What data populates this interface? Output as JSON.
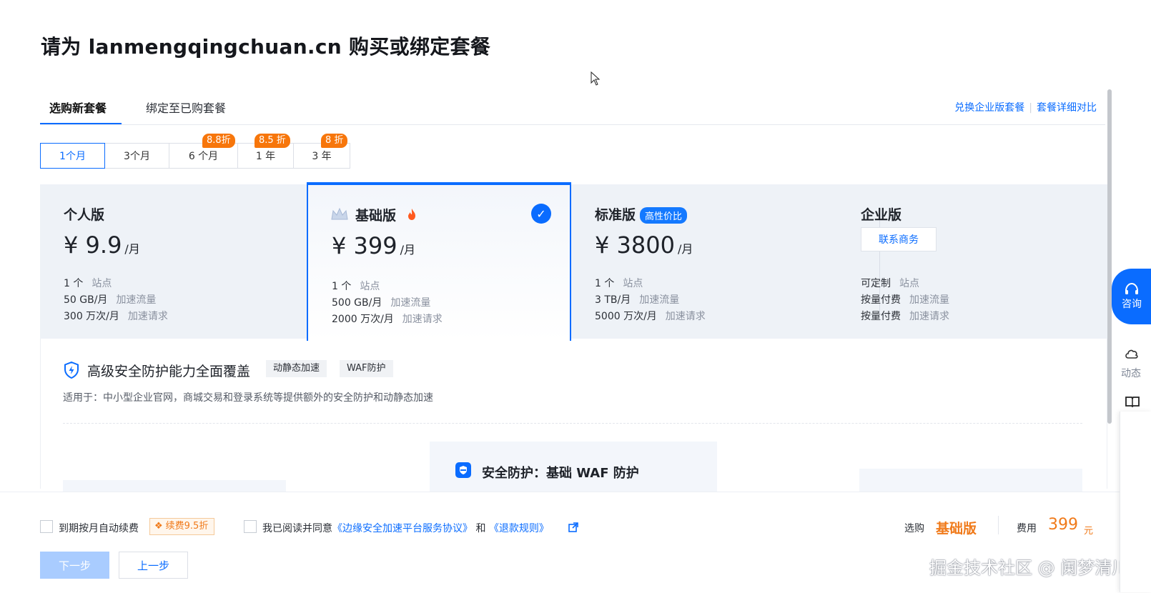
{
  "page": {
    "title": "请为 lanmengqingchuan.cn 购买或绑定套餐"
  },
  "tabs": [
    {
      "label": "选购新套餐",
      "active": true
    },
    {
      "label": "绑定至已购套餐",
      "active": false
    }
  ],
  "top_links": {
    "redeem": "兑换企业版套餐",
    "compare": "套餐详细对比"
  },
  "durations": [
    {
      "label": "1个月",
      "active": true,
      "discount": ""
    },
    {
      "label": "3个月",
      "active": false,
      "discount": ""
    },
    {
      "label": "6 个月",
      "active": false,
      "discount": "8.8折"
    },
    {
      "label": "1 年",
      "active": false,
      "discount": "8.5 折"
    },
    {
      "label": "3 年",
      "active": false,
      "discount": "8 折"
    }
  ],
  "plans": [
    {
      "name": "个人版",
      "currency": "¥",
      "price": "9.9",
      "unit": "/月",
      "site_v": "1 个",
      "site_k": "站点",
      "traffic_v": "50 GB/月",
      "traffic_k": "加速流量",
      "req_v": "300 万次/月",
      "req_k": "加速请求"
    },
    {
      "name": "基础版",
      "currency": "¥",
      "price": "399",
      "unit": "/月",
      "site_v": "1 个",
      "site_k": "站点",
      "traffic_v": "500 GB/月",
      "traffic_k": "加速流量",
      "req_v": "2000 万次/月",
      "req_k": "加速请求",
      "selected": true
    },
    {
      "name": "标准版",
      "badge": "高性价比",
      "currency": "¥",
      "price": "3800",
      "unit": "/月",
      "site_v": "1 个",
      "site_k": "站点",
      "traffic_v": "3 TB/月",
      "traffic_k": "加速流量",
      "req_v": "5000 万次/月",
      "req_k": "加速请求"
    },
    {
      "name": "企业版",
      "contact": "联系商务",
      "site_v": "可定制",
      "site_k": "站点",
      "traffic_v": "按量付费",
      "traffic_k": "加速流量",
      "req_v": "按量付费",
      "req_k": "加速请求"
    }
  ],
  "features": {
    "title": "高级安全防护能力全面覆盖",
    "tags": [
      "动静态加速",
      "WAF防护"
    ],
    "desc": "适用于：中小型企业官网，商城交易和登录系统等提供额外的安全防护和动静态加速",
    "card_title": "安全防护：基础 WAF 防护"
  },
  "footer": {
    "auto_renew": "到期按月自动续费",
    "renew_tag": "续费9.5折",
    "agree_prefix": "我已阅读并同意",
    "agreement": "《边缘安全加速平台服务协议》",
    "and": "和",
    "refund": "《退款规则》",
    "selected_label": "选购",
    "selected_plan": "基础版",
    "fee_label": "费用",
    "fee": "399",
    "fee_unit": "元",
    "next": "下一步",
    "prev": "上一步",
    "watermark": "掘金技术社区 @ 阑梦清川"
  },
  "side": {
    "consult": "咨询",
    "activity": "动态"
  },
  "colors": {
    "primary": "#0a6cff",
    "discount": "#f7760b",
    "price_accent": "#f07a1a"
  }
}
